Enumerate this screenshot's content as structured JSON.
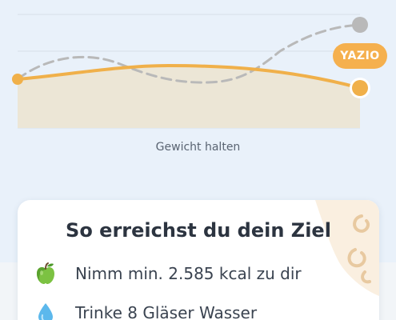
{
  "chart": {
    "caption": "Gewicht halten",
    "brand_badge": "YAZIO",
    "colors": {
      "primary_line": "#f0b04a",
      "dashed_line": "#b9b9b9",
      "fill": "#ece6d6",
      "grid": "#d6dee8"
    }
  },
  "card": {
    "title": "So erreichst du dein Ziel",
    "tips": [
      {
        "icon": "green-apple-icon",
        "text": "Nimm min. 2.585 kcal zu dir"
      },
      {
        "icon": "water-drop-icon",
        "text": "Trinke 8 Gläser Wasser"
      }
    ]
  }
}
